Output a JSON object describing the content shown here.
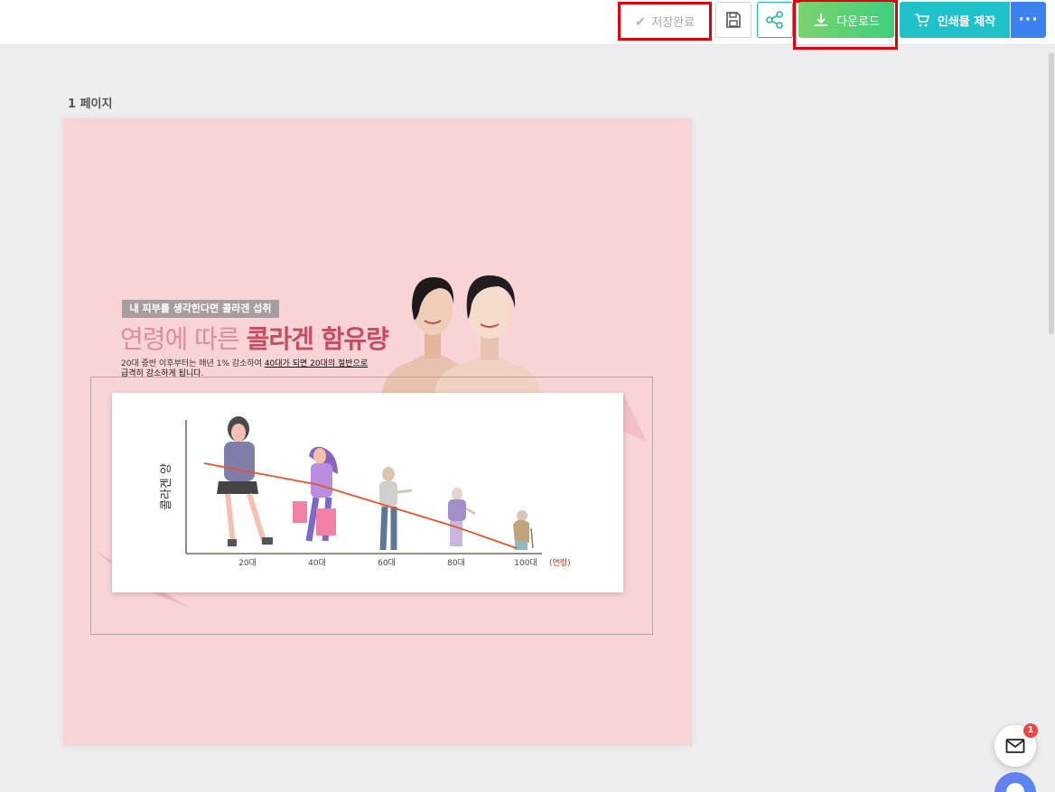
{
  "toolbar": {
    "saved_label": "저장완료",
    "save_icon": "floppy-disk-icon",
    "share_icon": "share-icon",
    "download_label": "다운로드",
    "print_label": "인쇄물 제작",
    "more_label": "···",
    "colors": {
      "download": "#4cd07b",
      "print": "#1fc2c9",
      "more": "#3b82f0",
      "highlight": "#e0000b"
    }
  },
  "canvas": {
    "page_label": "1 페이지",
    "background": "#f9d4d7"
  },
  "design": {
    "tag": "내 피부를 생각한다면 콜라겐 섭취",
    "headline_light": "연령에 따른 ",
    "headline_bold": "콜라겐 함유량",
    "desc_plain": "20대 중반 이후부터는 매년 1% 감소하여 ",
    "desc_underline1": "40대가 되면 20대의 절반으로",
    "desc_underline2": "급격히 감소하게 됩니다."
  },
  "chart_data": {
    "type": "line",
    "ylabel": "콜라겐 양",
    "xlabel": "(연령)",
    "categories": [
      "20대",
      "40대",
      "60대",
      "80대",
      "100대"
    ],
    "series": [
      {
        "values": [
          100,
          80,
          60,
          40,
          20
        ],
        "color": "#e8532a"
      }
    ]
  },
  "notification": {
    "badge_count": "1",
    "icon": "mail-icon"
  }
}
